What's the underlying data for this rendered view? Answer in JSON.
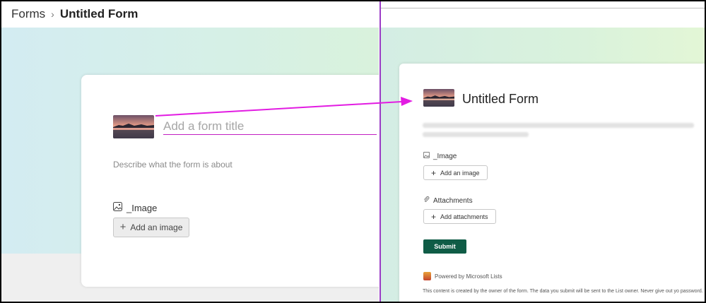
{
  "breadcrumb": {
    "root": "Forms",
    "separator": "›",
    "current": "Untitled Form"
  },
  "left": {
    "title_placeholder": "Add a form title",
    "description_placeholder": "Describe what the form is about",
    "image_label": "_Image",
    "add_image_label": "Add an image"
  },
  "right": {
    "form_title": "Untitled Form",
    "image_label": "_Image",
    "add_image_label": "Add an image",
    "attachments_label": "Attachments",
    "add_attachments_label": "Add attachments",
    "submit_label": "Submit",
    "powered_by": "Powered by Microsoft Lists",
    "notice": "This content is created by the owner of the form. The data you submit will be sent to the List owner. Never give out yo password."
  },
  "icons": {
    "image": "image-icon",
    "plus": "plus-icon",
    "paperclip": "paperclip-icon",
    "lists": "microsoft-lists-icon"
  },
  "colors": {
    "accent_green": "#0f5c46",
    "arrow": "#e21ce2",
    "divider": "#9b3cc6"
  }
}
